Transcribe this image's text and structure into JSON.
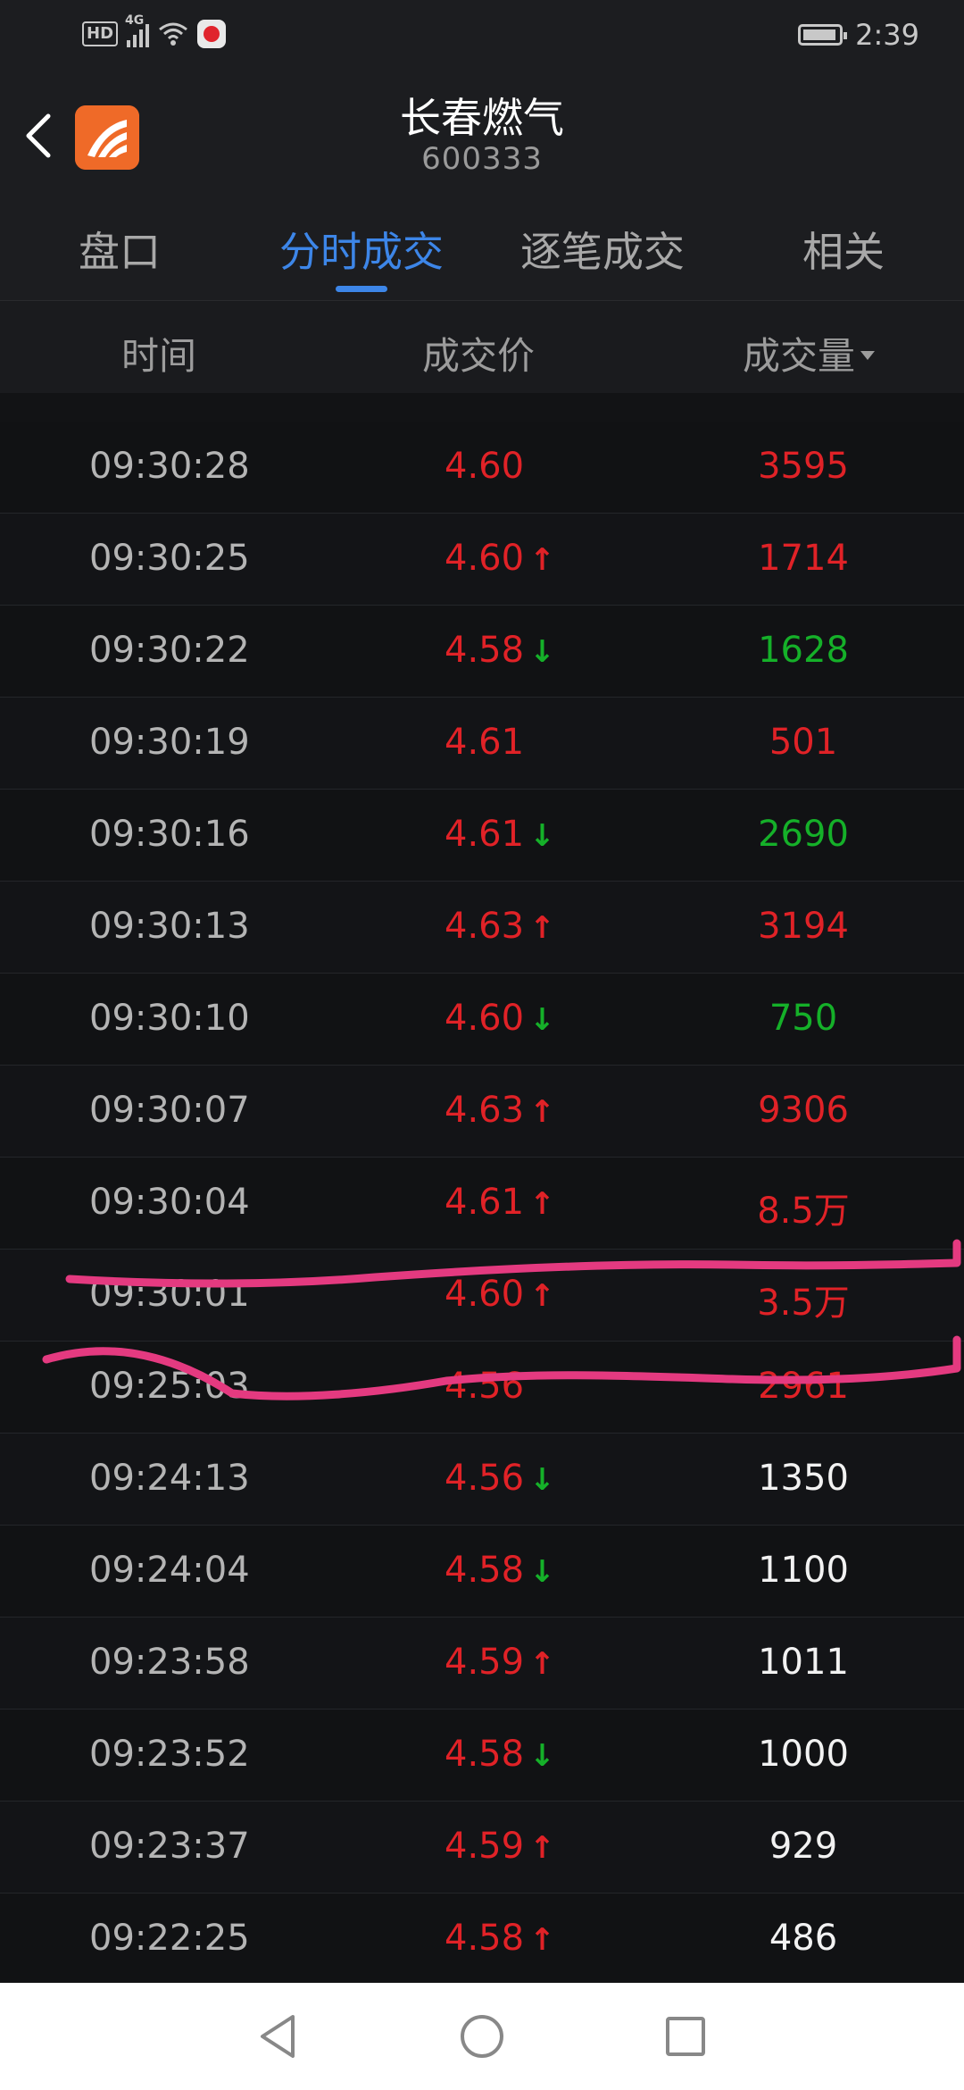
{
  "status_bar": {
    "hd": "HD",
    "net": "4G",
    "time": "2:39",
    "icons": [
      "hd-icon",
      "signal-icon",
      "wifi-icon",
      "app-notification-icon",
      "battery-icon"
    ]
  },
  "header": {
    "title": "长春燃气",
    "code": "600333"
  },
  "tabs": [
    {
      "label": "盘口"
    },
    {
      "label": "分时成交"
    },
    {
      "label": "逐笔成交"
    },
    {
      "label": "相关"
    }
  ],
  "active_tab": "分时成交",
  "columns": {
    "time": "时间",
    "price": "成交价",
    "volume": "成交量"
  },
  "colors": {
    "up_red": "#e02227",
    "down_green": "#15b029",
    "active_blue": "#3d86e8",
    "annotation_pink": "#e43a80"
  },
  "rows": [
    {
      "time": "09:30:28",
      "price": "4.60",
      "dir": "none",
      "volume": "3595",
      "vol_color": "red"
    },
    {
      "time": "09:30:25",
      "price": "4.60",
      "dir": "up",
      "volume": "1714",
      "vol_color": "red"
    },
    {
      "time": "09:30:22",
      "price": "4.58",
      "dir": "down",
      "volume": "1628",
      "vol_color": "green"
    },
    {
      "time": "09:30:19",
      "price": "4.61",
      "dir": "none",
      "volume": "501",
      "vol_color": "red"
    },
    {
      "time": "09:30:16",
      "price": "4.61",
      "dir": "down",
      "volume": "2690",
      "vol_color": "green"
    },
    {
      "time": "09:30:13",
      "price": "4.63",
      "dir": "up",
      "volume": "3194",
      "vol_color": "red"
    },
    {
      "time": "09:30:10",
      "price": "4.60",
      "dir": "down",
      "volume": "750",
      "vol_color": "green"
    },
    {
      "time": "09:30:07",
      "price": "4.63",
      "dir": "up",
      "volume": "9306",
      "vol_color": "red"
    },
    {
      "time": "09:30:04",
      "price": "4.61",
      "dir": "up",
      "volume": "8.5万",
      "vol_color": "red"
    },
    {
      "time": "09:30:01",
      "price": "4.60",
      "dir": "up",
      "volume": "3.5万",
      "vol_color": "red"
    },
    {
      "time": "09:25:03",
      "price": "4.56",
      "dir": "none",
      "volume": "2961",
      "vol_color": "red"
    },
    {
      "time": "09:24:13",
      "price": "4.56",
      "dir": "down",
      "volume": "1350",
      "vol_color": "white"
    },
    {
      "time": "09:24:04",
      "price": "4.58",
      "dir": "down",
      "volume": "1100",
      "vol_color": "white"
    },
    {
      "time": "09:23:58",
      "price": "4.59",
      "dir": "up",
      "volume": "1011",
      "vol_color": "white"
    },
    {
      "time": "09:23:52",
      "price": "4.58",
      "dir": "down",
      "volume": "1000",
      "vol_color": "white"
    },
    {
      "time": "09:23:37",
      "price": "4.59",
      "dir": "up",
      "volume": "929",
      "vol_color": "white"
    },
    {
      "time": "09:22:25",
      "price": "4.58",
      "dir": "up",
      "volume": "486",
      "vol_color": "white"
    }
  ],
  "nav": {
    "icons": [
      "back-triangle-icon",
      "home-circle-icon",
      "recents-square-icon"
    ]
  }
}
